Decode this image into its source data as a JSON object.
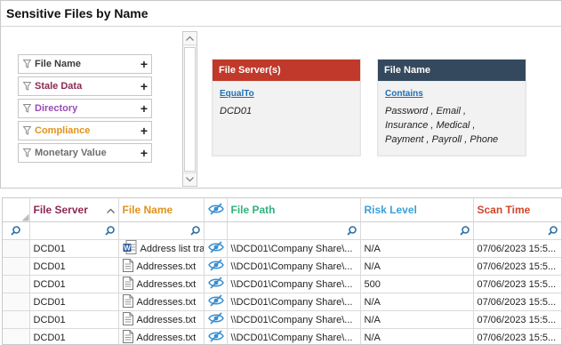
{
  "panel": {
    "title": "Sensitive Files by Name"
  },
  "filters": [
    {
      "label": "File Name",
      "color": "#3a3a3a"
    },
    {
      "label": "Stale Data",
      "color": "#8b2a52"
    },
    {
      "label": "Directory",
      "color": "#9a4ab3"
    },
    {
      "label": "Compliance",
      "color": "#e0931c"
    },
    {
      "label": "Monetary Value",
      "color": "#6e6e6e"
    }
  ],
  "cards": [
    {
      "header": "File Server(s)",
      "header_color": "#c0392b",
      "operator": "EqualTo",
      "values": [
        "DCD01"
      ]
    },
    {
      "header": "File Name",
      "header_color": "#34495e",
      "operator": "Contains",
      "values": [
        "Password , Email ,",
        "Insurance , Medical ,",
        "Payment , Payroll , Phone"
      ]
    }
  ],
  "grid": {
    "columns": [
      {
        "label": "File Server",
        "color": "#8b2a52"
      },
      {
        "label": "File Name",
        "color": "#e0931c"
      },
      {
        "label": "File Path",
        "color": "#2fb37a"
      },
      {
        "label": "Risk Level",
        "color": "#3aa0d8"
      },
      {
        "label": "Scan Time",
        "color": "#d2452a"
      }
    ],
    "rows": [
      {
        "server": "DCD01",
        "file_icon": "word-doc-icon",
        "name": "Address list tra...",
        "path": "\\\\DCD01\\Company Share\\...",
        "risk": "N/A",
        "scan": "07/06/2023 15:5..."
      },
      {
        "server": "DCD01",
        "file_icon": "text-file-icon",
        "name": "Addresses.txt",
        "path": "\\\\DCD01\\Company Share\\...",
        "risk": "N/A",
        "scan": "07/06/2023 15:5..."
      },
      {
        "server": "DCD01",
        "file_icon": "text-file-icon",
        "name": "Addresses.txt",
        "path": "\\\\DCD01\\Company Share\\...",
        "risk": "500",
        "scan": "07/06/2023 15:5..."
      },
      {
        "server": "DCD01",
        "file_icon": "text-file-icon",
        "name": "Addresses.txt",
        "path": "\\\\DCD01\\Company Share\\...",
        "risk": "N/A",
        "scan": "07/06/2023 15:5..."
      },
      {
        "server": "DCD01",
        "file_icon": "text-file-icon",
        "name": "Addresses.txt",
        "path": "\\\\DCD01\\Company Share\\...",
        "risk": "N/A",
        "scan": "07/06/2023 15:5..."
      },
      {
        "server": "DCD01",
        "file_icon": "text-file-icon",
        "name": "Addresses.txt",
        "path": "\\\\DCD01\\Company Share\\...",
        "risk": "N/A",
        "scan": "07/06/2023 15:5..."
      }
    ]
  }
}
